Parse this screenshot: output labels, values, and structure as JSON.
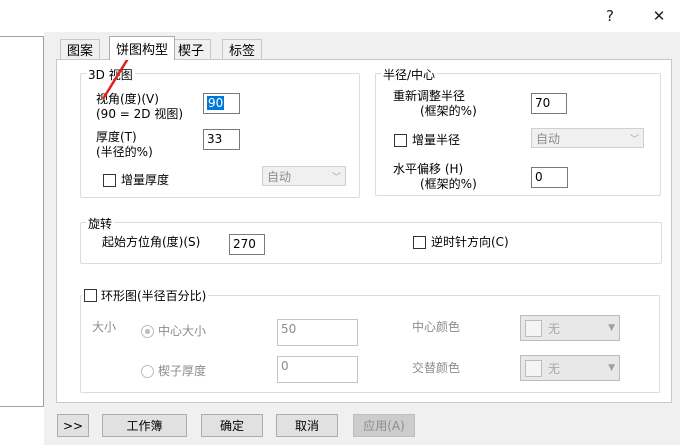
{
  "titlebar": {
    "help_label": "?",
    "close_label": "✕"
  },
  "tabs": [
    {
      "label": "图案"
    },
    {
      "label": "饼图构型"
    },
    {
      "label": "楔子"
    },
    {
      "label": "标签"
    }
  ],
  "view3d": {
    "legend": "3D 视图",
    "view_angle_label_1": "视角(度)(V)",
    "view_angle_label_2": "(90 = 2D 视图)",
    "view_angle_value": "90",
    "thickness_label_1": "厚度(T)",
    "thickness_label_2": "(半径的%)",
    "thickness_value": "33",
    "incr_thickness_label": "增量厚度",
    "incr_thickness_combo": "自动"
  },
  "radius": {
    "legend": "半径/中心",
    "resize_label_1": "重新调整半径",
    "resize_label_2": "(框架的%)",
    "resize_value": "70",
    "incr_radius_label": "增量半径",
    "incr_radius_combo": "自动",
    "hoffset_label_1": "水平偏移 (H)",
    "hoffset_label_2": "(框架的%)",
    "hoffset_value": "0"
  },
  "rotation": {
    "legend": "旋转",
    "start_angle_label": "起始方位角(度)(S)",
    "start_angle_value": "270",
    "ccw_label": "逆时针方向(C)"
  },
  "ring": {
    "legend": "环形图(半径百分比)",
    "size_label": "大小",
    "center_size_label": "中心大小",
    "center_size_value": "50",
    "wedge_thickness_label": "楔子厚度",
    "wedge_thickness_value": "0",
    "center_color_label": "中心颜色",
    "center_color_value": "无",
    "alt_color_label": "交替颜色",
    "alt_color_value": "无"
  },
  "buttons": {
    "expand": ">>",
    "workbook": "工作簿",
    "ok": "确定",
    "cancel": "取消",
    "apply": "应用(A)"
  },
  "colors": {
    "annotation_arrow": "#e02020",
    "selection": "#0078d7"
  },
  "icons": [
    "help-icon",
    "close-icon",
    "chevron-down-icon",
    "red-arrow-annotation"
  ]
}
